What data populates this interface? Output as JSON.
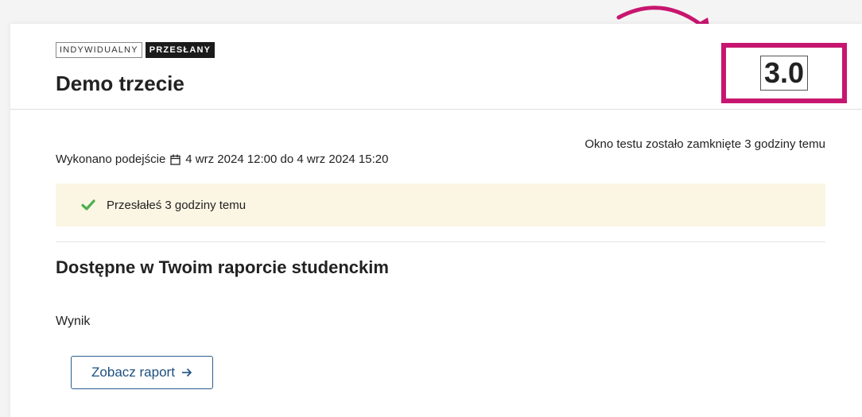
{
  "assignment": {
    "badges": [
      "INDYWIDUALNY",
      "PRZESŁANY"
    ],
    "title": "Demo trzecie",
    "score": "3.0",
    "window_status": "Okno testu zostało zamknięte 3 godziny temu",
    "attempt_label": "Wykonano podejście",
    "attempt_range": "4 wrz 2024 12:00 do 4 wrz 2024 15:20",
    "submitted_message": "Przesłałeś 3 godziny temu",
    "section_title": "Dostępne w Twoim raporcie studenckim",
    "result_label": "Wynik",
    "report_button": "Zobacz raport"
  },
  "colors": {
    "highlight": "#c7166f",
    "success_bg": "#fbf5e3",
    "check": "#4caf50",
    "button": "#1e4f80"
  },
  "icons": [
    "calendar-icon",
    "check-icon",
    "arrow-right-icon",
    "curved-arrow-annotation"
  ]
}
